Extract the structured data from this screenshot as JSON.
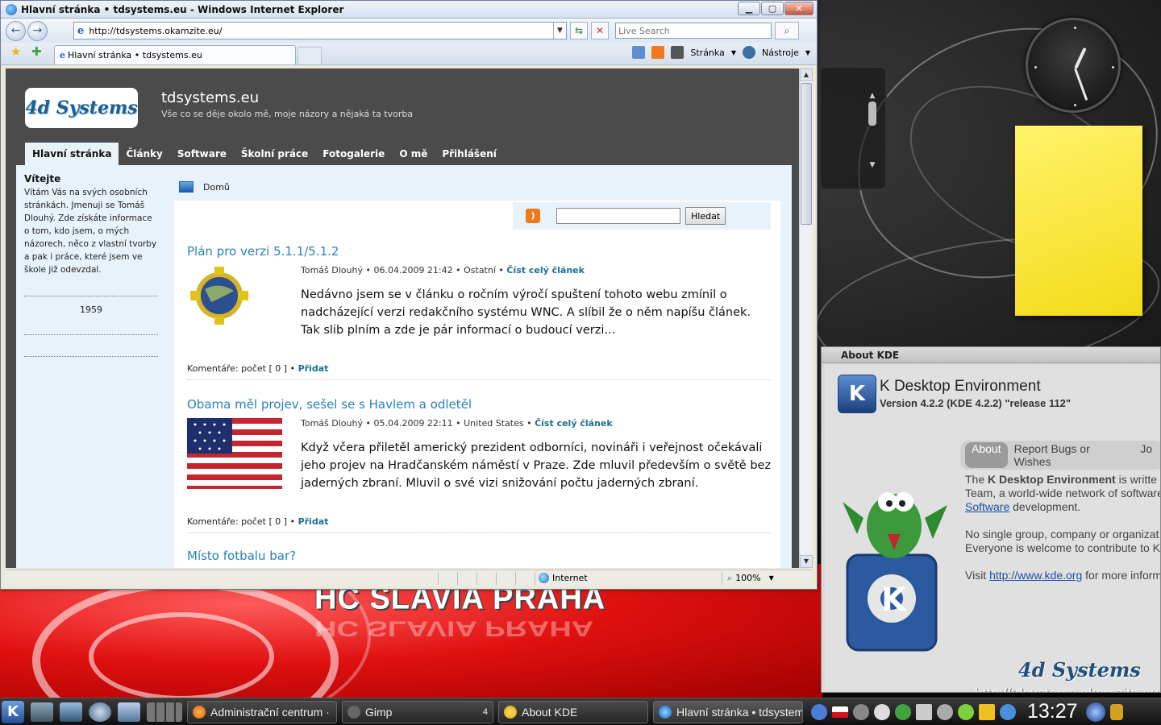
{
  "ie": {
    "window_title": "Hlavní stránka • tdsystems.eu - Windows Internet Explorer",
    "address": "http://tdsystems.okamzite.eu/",
    "live_search_placeholder": "Live Search",
    "tab_title": "Hlavní stránka • tdsystems.eu",
    "cmd_page": "Stránka",
    "cmd_tools": "Nástroje",
    "status_zone": "Internet",
    "zoom": "100%"
  },
  "site": {
    "logo_text": "4d Systems",
    "title": "tdsystems.eu",
    "subtitle": "Vše co se děje okolo mě, moje názory a nějaká ta tvorba",
    "nav": [
      {
        "label": "Hlavní stránka"
      },
      {
        "label": "Články"
      },
      {
        "label": "Software"
      },
      {
        "label": "Školní práce"
      },
      {
        "label": "Fotogalerie"
      },
      {
        "label": "O mě"
      },
      {
        "label": "Přihlášení"
      }
    ],
    "sidebar": {
      "welcome_title": "Vítejte",
      "welcome_text": "Vítám Vás na svých osobních stránkách. Jmenuji se Tomáš Dlouhý. Zde získáte informace o tom, kdo jsem, o mých názorech, něco z vlastní tvorby a pak i práce, které jsem ve škole již odevzdal.",
      "year": "1959"
    },
    "breadcrumb": "Domů",
    "search_button": "Hledat",
    "rss_label": "RSS",
    "articles": [
      {
        "title": "Plán pro verzi 5.1.1/5.1.2",
        "meta": "Tomáš Dlouhý • 06.04.2009 21:42 • Ostatní •",
        "read_more": "Číst celý článek",
        "text": "Nedávno jsem se v článku o ročním výročí spuštení tohoto webu zmínil o nadcházející verzi redakčního systému WNC. A slíbil že o něm napíšu článek. Tak slib plním a zde je pár informací o budoucí verzi...",
        "comments": "Komentáře: počet [ 0 ] •",
        "add": "Přidat"
      },
      {
        "title": "Obama měl projev, sešel se s Havlem a odletěl",
        "meta": "Tomáš Dlouhý • 05.04.2009 22:11 • United States •",
        "read_more": "Číst celý článek",
        "text": "Když včera přiletěl americký prezident odborníci, novináři i veřejnost očekávali jeho projev na Hradčanském náměstí v Praze. Zde mluvil především o světě bez jaderných zbraní. Mluvil o své vizi snižování počtu jaderných zbraní.",
        "comments": "Komentáře: počet [ 0 ] •",
        "add": "Přidat"
      },
      {
        "title": "Místo fotbalu bar?"
      }
    ]
  },
  "wallpaper": {
    "text": "HC SLAVIA PRAHA"
  },
  "about_kde": {
    "window_title": "About KDE",
    "name": "K Desktop Environment",
    "version": "Version 4.2.2 (KDE 4.2.2) \"release 112\"",
    "tabs": [
      "About",
      "Report Bugs or Wishes",
      "Jo"
    ],
    "para1_pre": "The ",
    "para1_bold": "K Desktop Environment",
    "para1_post": " is writte",
    "para1_line2": "Team, a world-wide network of software",
    "para1_link": "Software",
    "para1_tail": " development.",
    "para2_line1": "No single group, company or organizat",
    "para2_line2": "Everyone is welcome to contribute to K",
    "para3_pre": "Visit ",
    "para3_link": "http://www.kde.org",
    "para3_post": " for more inform",
    "watermark_url": "http://tdsystems.okamzite.eu"
  },
  "taskbar": {
    "tasks": [
      "Administrační centrum ·",
      "Gimp",
      "About KDE",
      "Hlavní stránka • tdsystem"
    ],
    "gimp_count": "4",
    "clock": "13:27"
  }
}
